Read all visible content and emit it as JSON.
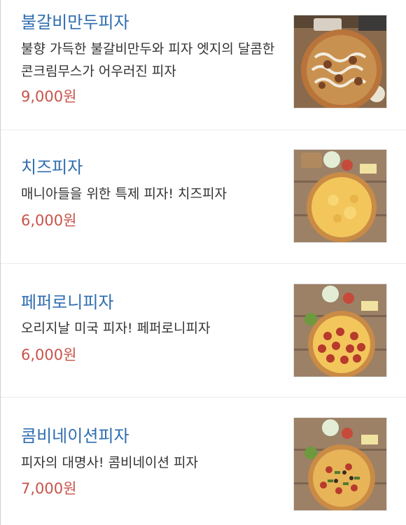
{
  "menu": {
    "items": [
      {
        "name": "불갈비만두피자",
        "description": "불향 가득한 불갈비만두와 피자 엣지의 달콤한 콘크림무스가 어우러진 피자",
        "price": "9,000원",
        "image_icon": "pizza-thumbnail-icon"
      },
      {
        "name": "치즈피자",
        "description": "매니아들을 위한 특제 피자! 치즈피자",
        "price": "6,000원",
        "image_icon": "pizza-thumbnail-icon"
      },
      {
        "name": "페퍼로니피자",
        "description": "오리지날 미국 피자! 페퍼로니피자",
        "price": "6,000원",
        "image_icon": "pizza-thumbnail-icon"
      },
      {
        "name": "콤비네이션피자",
        "description": "피자의 대명사! 콤비네이션 피자",
        "price": "7,000원",
        "image_icon": "pizza-thumbnail-icon"
      }
    ]
  },
  "colors": {
    "name_text": "#2f6db0",
    "price_text": "#c8534a",
    "description_text": "#333333",
    "divider": "#ececec"
  }
}
